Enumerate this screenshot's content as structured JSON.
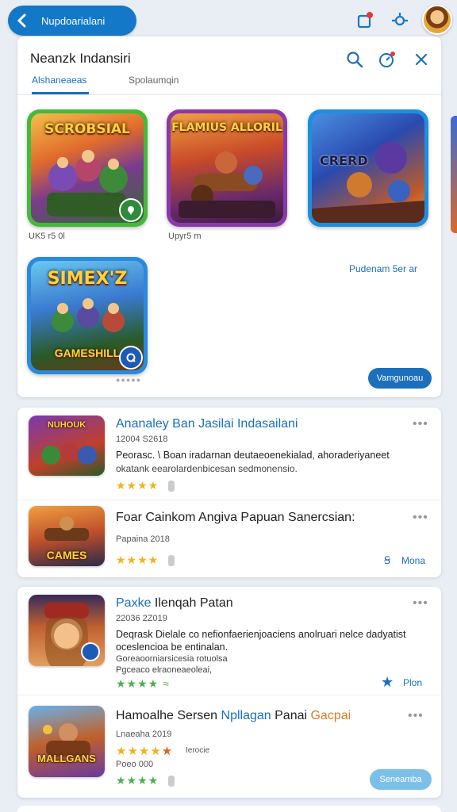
{
  "topbar": {
    "back_label": "Nupdoarialani",
    "icons": [
      "back-chevron-icon",
      "notification-icon",
      "share-icon"
    ]
  },
  "panel": {
    "title": "Neanzk Indansiri",
    "tabs": [
      "Alshaneaeas",
      "Spolaumqin"
    ]
  },
  "tiles": [
    {
      "title": "SCROBSIAL",
      "caption": "UK5 r5 0l"
    },
    {
      "title": "FLAMIUS ALLORIL",
      "caption": "Upyr5 m"
    },
    {
      "title": "CRERD",
      "caption": ""
    },
    {
      "title": "SIMEX'Z",
      "bottom": "GAMESHILL",
      "caption": ""
    }
  ],
  "panel_link": "Pudenam 5er ar",
  "panel_button": "Vamgunoau",
  "list1": [
    {
      "thumb": "NUHOUK",
      "title": "Ananaley Ban Jasilai Indasailani",
      "meta": "12004 S2618",
      "desc1": "Peorasc. \\ Boan iradarnan deutaeoenekialad, ahoraderiyaneet",
      "desc2": "okatank eearolardenbicesan sedmonensio.",
      "stars": "★★★★",
      "more": "•••"
    },
    {
      "thumb": "CAMES",
      "title": "Foar Cainkom Angiva Papuan Sanercsian:",
      "meta": "Papaina 2018",
      "stars": "★★★★",
      "link": "Mona",
      "more": "•••"
    }
  ],
  "list2": [
    {
      "title": "Paxke Ilenqah Patan",
      "meta": "22036 2Z019",
      "desc1": "Deqrask Dielale co nefionfaerienjoaciens anolruari nelce dadyatist",
      "desc2": "oceslencioa be entinalan.",
      "desc3": "Goreaoorniarsicesia rotuolsa",
      "desc4": "Pgceaco elraoneaeoleai,",
      "stars": "★★★★ ≈",
      "link": "Plon",
      "more": "•••"
    },
    {
      "thumb": "MALLGANS",
      "title": "Hamoalhe Sersen Npllagan Panai Gacpai",
      "title_part1": "Hamoalhe Sersen ",
      "title_part2": "Npllagan",
      "title_part3": " Panai ",
      "title_part4": "Gacpai",
      "meta": "Lnaeaha 2019",
      "stars": "★★★★★",
      "stars_label": "Ierocie",
      "meta2": "Poeo 000",
      "stars2": "★★★★",
      "button": "Seneamba",
      "more": "•••"
    }
  ],
  "colors": {
    "accent": "#1a6fbf",
    "topbar_pill": "#1478c8",
    "star": "#f2b21a",
    "star_green": "#4caf50",
    "button_blue": "#1c6fbc",
    "button_light": "#7cc0ea"
  }
}
